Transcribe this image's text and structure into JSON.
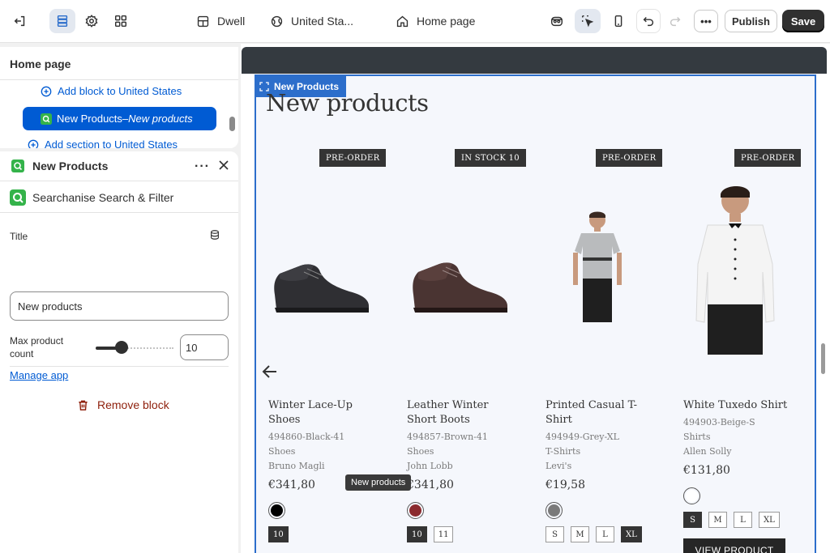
{
  "topbar": {
    "theme_name": "Dwell",
    "market": "United Sta...",
    "page": "Home page",
    "publish_label": "Publish",
    "save_label": "Save"
  },
  "sidebar": {
    "title": "Home page",
    "add_block_label": "Add block to United States",
    "selected_item": {
      "label": "New Products",
      "separator": " – ",
      "sublabel": "New products"
    },
    "add_section_label": "Add section to United States"
  },
  "block_panel": {
    "title": "New Products",
    "app_name": "Searchanise Search & Filter",
    "title_label": "Title",
    "title_value": "New products",
    "max_label": "Max product count",
    "max_value": "10",
    "max_fraction": 0.33,
    "manage_label": "Manage app",
    "remove_label": "Remove block"
  },
  "preview": {
    "badge": "New Products",
    "heading": "New products",
    "tooltip": "New products",
    "products": [
      {
        "badge": "PRE-ORDER",
        "name": "Winter Lace-Up Shoes",
        "sku": "494860-Black-41",
        "type": "Shoes",
        "vendor": "Bruno Magli",
        "price": "€341,80",
        "swatch": "#000000",
        "sizes": [
          "10"
        ],
        "selected": "10"
      },
      {
        "badge": "IN STOCK 10",
        "name": "Leather Winter Short Boots",
        "sku": "494857-Brown-41",
        "type": "Shoes",
        "vendor": "John Lobb",
        "price": "€341,80",
        "swatch": "#8b2a2e",
        "sizes": [
          "10",
          "11"
        ],
        "selected": "10"
      },
      {
        "badge": "PRE-ORDER",
        "name": "Printed Casual T-Shirt",
        "sku": "494949-Grey-XL",
        "type": "T-Shirts",
        "vendor": "Levi's",
        "price": "€19,58",
        "swatch": "#7a7a7a",
        "sizes": [
          "S",
          "M",
          "L",
          "XL"
        ],
        "selected": "XL"
      },
      {
        "badge": "PRE-ORDER",
        "name": "White Tuxedo Shirt",
        "sku": "494903-Beige-S",
        "type": "Shirts",
        "vendor": "Allen Solly",
        "price": "€131,80",
        "swatch": "#ffffff",
        "sizes": [
          "S",
          "M",
          "L",
          "XL"
        ],
        "selected": "S",
        "button": "VIEW PRODUCT"
      }
    ]
  },
  "colors": {
    "accent": "#005bd3",
    "frame": "#2c6ecb",
    "remove": "#8e1f0b"
  }
}
